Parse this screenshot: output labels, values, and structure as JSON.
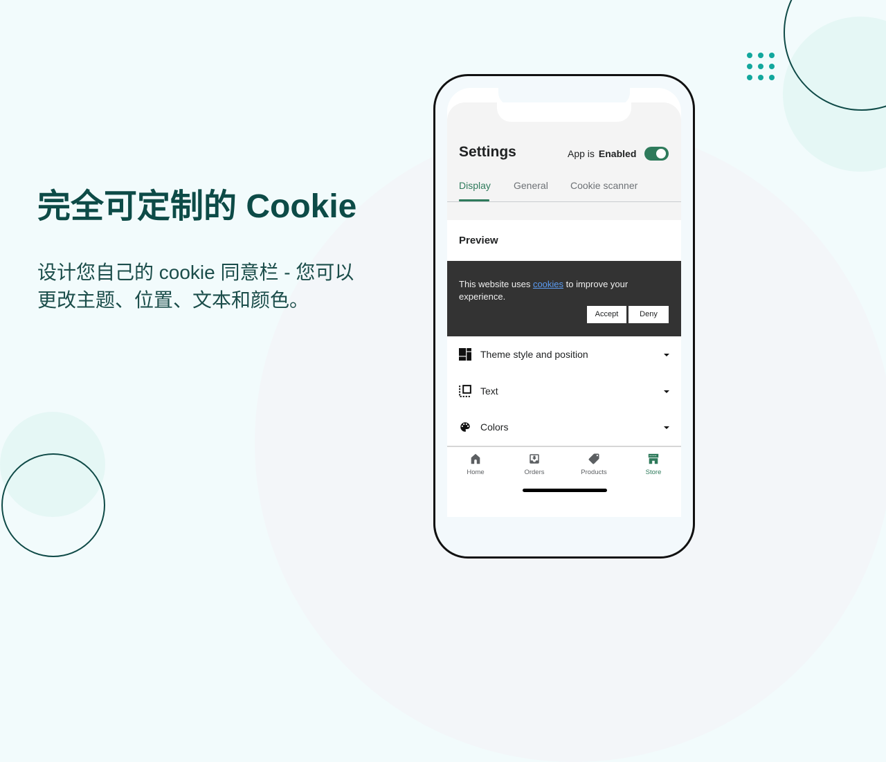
{
  "hero": {
    "title": "完全可定制的 Cookie",
    "description_lines": [
      "设计您自己的 cookie 同意栏 - 您可以",
      "更改主题、位置、文本和颜色。"
    ]
  },
  "colors": {
    "accent": "#2e7a5b",
    "heading": "#0d4b47",
    "dots": "#12a79d",
    "banner_bg": "#333333",
    "link": "#5b9cf2"
  },
  "app": {
    "title": "Settings",
    "status_prefix": "App is",
    "status_value": "Enabled",
    "toggle_on": true,
    "tabs": [
      {
        "label": "Display",
        "active": true
      },
      {
        "label": "General",
        "active": false
      },
      {
        "label": "Cookie scanner",
        "active": false
      }
    ],
    "preview": {
      "title": "Preview",
      "banner": {
        "text_before": "This website uses ",
        "link": "cookies",
        "text_after": " to improve your experience.",
        "accept": "Accept",
        "deny": "Deny"
      }
    },
    "sections": [
      {
        "label": "Theme style and position",
        "icon": "dashboard-icon"
      },
      {
        "label": "Text",
        "icon": "select-text-icon"
      },
      {
        "label": "Colors",
        "icon": "palette-icon"
      }
    ],
    "nav": [
      {
        "label": "Home",
        "icon": "home-icon",
        "active": false
      },
      {
        "label": "Orders",
        "icon": "orders-icon",
        "active": false
      },
      {
        "label": "Products",
        "icon": "tag-icon",
        "active": false
      },
      {
        "label": "Store",
        "icon": "store-icon",
        "active": true
      }
    ]
  }
}
